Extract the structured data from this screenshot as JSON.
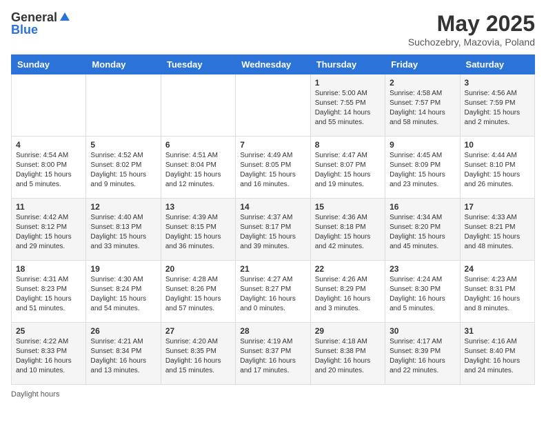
{
  "header": {
    "logo_general": "General",
    "logo_blue": "Blue",
    "month_title": "May 2025",
    "subtitle": "Suchozebry, Mazovia, Poland"
  },
  "days_of_week": [
    "Sunday",
    "Monday",
    "Tuesday",
    "Wednesday",
    "Thursday",
    "Friday",
    "Saturday"
  ],
  "weeks": [
    [
      {
        "day": "",
        "sunrise": "",
        "sunset": "",
        "daylight": ""
      },
      {
        "day": "",
        "sunrise": "",
        "sunset": "",
        "daylight": ""
      },
      {
        "day": "",
        "sunrise": "",
        "sunset": "",
        "daylight": ""
      },
      {
        "day": "",
        "sunrise": "",
        "sunset": "",
        "daylight": ""
      },
      {
        "day": "1",
        "sunrise": "Sunrise: 5:00 AM",
        "sunset": "Sunset: 7:55 PM",
        "daylight": "Daylight: 14 hours and 55 minutes."
      },
      {
        "day": "2",
        "sunrise": "Sunrise: 4:58 AM",
        "sunset": "Sunset: 7:57 PM",
        "daylight": "Daylight: 14 hours and 58 minutes."
      },
      {
        "day": "3",
        "sunrise": "Sunrise: 4:56 AM",
        "sunset": "Sunset: 7:59 PM",
        "daylight": "Daylight: 15 hours and 2 minutes."
      }
    ],
    [
      {
        "day": "4",
        "sunrise": "Sunrise: 4:54 AM",
        "sunset": "Sunset: 8:00 PM",
        "daylight": "Daylight: 15 hours and 5 minutes."
      },
      {
        "day": "5",
        "sunrise": "Sunrise: 4:52 AM",
        "sunset": "Sunset: 8:02 PM",
        "daylight": "Daylight: 15 hours and 9 minutes."
      },
      {
        "day": "6",
        "sunrise": "Sunrise: 4:51 AM",
        "sunset": "Sunset: 8:04 PM",
        "daylight": "Daylight: 15 hours and 12 minutes."
      },
      {
        "day": "7",
        "sunrise": "Sunrise: 4:49 AM",
        "sunset": "Sunset: 8:05 PM",
        "daylight": "Daylight: 15 hours and 16 minutes."
      },
      {
        "day": "8",
        "sunrise": "Sunrise: 4:47 AM",
        "sunset": "Sunset: 8:07 PM",
        "daylight": "Daylight: 15 hours and 19 minutes."
      },
      {
        "day": "9",
        "sunrise": "Sunrise: 4:45 AM",
        "sunset": "Sunset: 8:09 PM",
        "daylight": "Daylight: 15 hours and 23 minutes."
      },
      {
        "day": "10",
        "sunrise": "Sunrise: 4:44 AM",
        "sunset": "Sunset: 8:10 PM",
        "daylight": "Daylight: 15 hours and 26 minutes."
      }
    ],
    [
      {
        "day": "11",
        "sunrise": "Sunrise: 4:42 AM",
        "sunset": "Sunset: 8:12 PM",
        "daylight": "Daylight: 15 hours and 29 minutes."
      },
      {
        "day": "12",
        "sunrise": "Sunrise: 4:40 AM",
        "sunset": "Sunset: 8:13 PM",
        "daylight": "Daylight: 15 hours and 33 minutes."
      },
      {
        "day": "13",
        "sunrise": "Sunrise: 4:39 AM",
        "sunset": "Sunset: 8:15 PM",
        "daylight": "Daylight: 15 hours and 36 minutes."
      },
      {
        "day": "14",
        "sunrise": "Sunrise: 4:37 AM",
        "sunset": "Sunset: 8:17 PM",
        "daylight": "Daylight: 15 hours and 39 minutes."
      },
      {
        "day": "15",
        "sunrise": "Sunrise: 4:36 AM",
        "sunset": "Sunset: 8:18 PM",
        "daylight": "Daylight: 15 hours and 42 minutes."
      },
      {
        "day": "16",
        "sunrise": "Sunrise: 4:34 AM",
        "sunset": "Sunset: 8:20 PM",
        "daylight": "Daylight: 15 hours and 45 minutes."
      },
      {
        "day": "17",
        "sunrise": "Sunrise: 4:33 AM",
        "sunset": "Sunset: 8:21 PM",
        "daylight": "Daylight: 15 hours and 48 minutes."
      }
    ],
    [
      {
        "day": "18",
        "sunrise": "Sunrise: 4:31 AM",
        "sunset": "Sunset: 8:23 PM",
        "daylight": "Daylight: 15 hours and 51 minutes."
      },
      {
        "day": "19",
        "sunrise": "Sunrise: 4:30 AM",
        "sunset": "Sunset: 8:24 PM",
        "daylight": "Daylight: 15 hours and 54 minutes."
      },
      {
        "day": "20",
        "sunrise": "Sunrise: 4:28 AM",
        "sunset": "Sunset: 8:26 PM",
        "daylight": "Daylight: 15 hours and 57 minutes."
      },
      {
        "day": "21",
        "sunrise": "Sunrise: 4:27 AM",
        "sunset": "Sunset: 8:27 PM",
        "daylight": "Daylight: 16 hours and 0 minutes."
      },
      {
        "day": "22",
        "sunrise": "Sunrise: 4:26 AM",
        "sunset": "Sunset: 8:29 PM",
        "daylight": "Daylight: 16 hours and 3 minutes."
      },
      {
        "day": "23",
        "sunrise": "Sunrise: 4:24 AM",
        "sunset": "Sunset: 8:30 PM",
        "daylight": "Daylight: 16 hours and 5 minutes."
      },
      {
        "day": "24",
        "sunrise": "Sunrise: 4:23 AM",
        "sunset": "Sunset: 8:31 PM",
        "daylight": "Daylight: 16 hours and 8 minutes."
      }
    ],
    [
      {
        "day": "25",
        "sunrise": "Sunrise: 4:22 AM",
        "sunset": "Sunset: 8:33 PM",
        "daylight": "Daylight: 16 hours and 10 minutes."
      },
      {
        "day": "26",
        "sunrise": "Sunrise: 4:21 AM",
        "sunset": "Sunset: 8:34 PM",
        "daylight": "Daylight: 16 hours and 13 minutes."
      },
      {
        "day": "27",
        "sunrise": "Sunrise: 4:20 AM",
        "sunset": "Sunset: 8:35 PM",
        "daylight": "Daylight: 16 hours and 15 minutes."
      },
      {
        "day": "28",
        "sunrise": "Sunrise: 4:19 AM",
        "sunset": "Sunset: 8:37 PM",
        "daylight": "Daylight: 16 hours and 17 minutes."
      },
      {
        "day": "29",
        "sunrise": "Sunrise: 4:18 AM",
        "sunset": "Sunset: 8:38 PM",
        "daylight": "Daylight: 16 hours and 20 minutes."
      },
      {
        "day": "30",
        "sunrise": "Sunrise: 4:17 AM",
        "sunset": "Sunset: 8:39 PM",
        "daylight": "Daylight: 16 hours and 22 minutes."
      },
      {
        "day": "31",
        "sunrise": "Sunrise: 4:16 AM",
        "sunset": "Sunset: 8:40 PM",
        "daylight": "Daylight: 16 hours and 24 minutes."
      }
    ]
  ],
  "footer": {
    "daylight_label": "Daylight hours"
  }
}
